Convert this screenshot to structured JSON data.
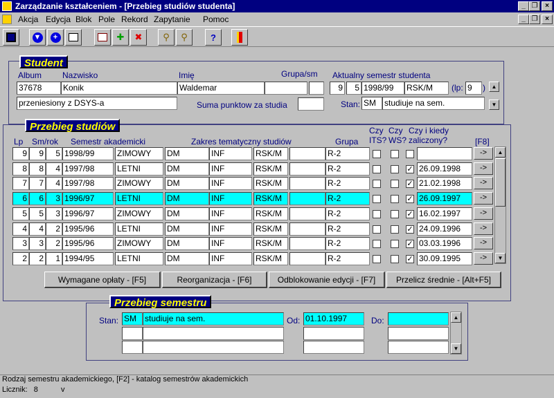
{
  "window": {
    "title": "Zarządzanie kształceniem - [Przebieg studiów studenta]"
  },
  "menu": [
    "Akcja",
    "Edycja",
    "Blok",
    "Pole",
    "Rekord",
    "Zapytanie",
    "Pomoc"
  ],
  "student": {
    "title": "Student",
    "labels": {
      "album": "Album",
      "nazwisko": "Nazwisko",
      "imie": "Imię",
      "grupa": "Grupa/sm",
      "aktualny": "Aktualny semestr studenta",
      "suma": "Suma punktow za studia",
      "stan": "Stan:",
      "lp_open": "(lp:",
      "lp_close": ")"
    },
    "album": "37678",
    "nazwisko": "Konik",
    "imie": "Waldemar",
    "grupa": "",
    "grupa_sm": "",
    "aktualny": {
      "a": "9",
      "b": "5",
      "year": "1998/99",
      "code": "RSK/M",
      "lp": "9"
    },
    "note": "przeniesiony z DSYS-a",
    "suma": "",
    "stan_code": "SM",
    "stan_text": "studiuje na sem."
  },
  "przebieg": {
    "title": "Przebieg studiów",
    "headers": {
      "lp": "Lp",
      "smrok": "Sm/rok",
      "sem": "Semestr akademicki",
      "zakres": "Zakres tematyczny studiów",
      "grupa": "Grupa",
      "czyits": "Czy ITS?",
      "czyws": "Czy WS?",
      "czykiedy": "Czy i kiedy zaliczony?",
      "f8": "[F8]"
    },
    "arrow_label": "->",
    "rows": [
      {
        "lp": "9",
        "sm": "9",
        "rok": "5",
        "year": "1998/99",
        "season": "ZIMOWY",
        "z1": "DM",
        "z2": "INF",
        "z3": "RSK/M",
        "grupa": "R-2",
        "its": "",
        "ws": "",
        "zal": "",
        "date": "",
        "active": false
      },
      {
        "lp": "8",
        "sm": "8",
        "rok": "4",
        "year": "1997/98",
        "season": "LETNI",
        "z1": "DM",
        "z2": "INF",
        "z3": "RSK/M",
        "grupa": "R-2",
        "its": "",
        "ws": "",
        "zal": "✓",
        "date": "26.09.1998",
        "active": false
      },
      {
        "lp": "7",
        "sm": "7",
        "rok": "4",
        "year": "1997/98",
        "season": "ZIMOWY",
        "z1": "DM",
        "z2": "INF",
        "z3": "RSK/M",
        "grupa": "R-2",
        "its": "",
        "ws": "",
        "zal": "✓",
        "date": "21.02.1998",
        "active": false
      },
      {
        "lp": "6",
        "sm": "6",
        "rok": "3",
        "year": "1996/97",
        "season": "LETNI",
        "z1": "DM",
        "z2": "INF",
        "z3": "RSK/M",
        "grupa": "R-2",
        "its": "",
        "ws": "",
        "zal": "✓",
        "date": "26.09.1997",
        "active": true
      },
      {
        "lp": "5",
        "sm": "5",
        "rok": "3",
        "year": "1996/97",
        "season": "ZIMOWY",
        "z1": "DM",
        "z2": "INF",
        "z3": "RSK/M",
        "grupa": "R-2",
        "its": "",
        "ws": "",
        "zal": "✓",
        "date": "16.02.1997",
        "active": false
      },
      {
        "lp": "4",
        "sm": "4",
        "rok": "2",
        "year": "1995/96",
        "season": "LETNI",
        "z1": "DM",
        "z2": "INF",
        "z3": "RSK/M",
        "grupa": "R-2",
        "its": "",
        "ws": "",
        "zal": "✓",
        "date": "24.09.1996",
        "active": false
      },
      {
        "lp": "3",
        "sm": "3",
        "rok": "2",
        "year": "1995/96",
        "season": "ZIMOWY",
        "z1": "DM",
        "z2": "INF",
        "z3": "RSK/M",
        "grupa": "R-2",
        "its": "",
        "ws": "",
        "zal": "✓",
        "date": "03.03.1996",
        "active": false
      },
      {
        "lp": "2",
        "sm": "2",
        "rok": "1",
        "year": "1994/95",
        "season": "LETNI",
        "z1": "DM",
        "z2": "INF",
        "z3": "RSK/M",
        "grupa": "R-2",
        "its": "",
        "ws": "",
        "zal": "✓",
        "date": "30.09.1995",
        "active": false
      }
    ],
    "buttons": {
      "oplaty": "Wymagane opłaty - [F5]",
      "reorg": "Reorganizacja - [F6]",
      "odblok": "Odblokowanie edycji - [F7]",
      "srednie": "Przelicz średnie - [Alt+F5]"
    }
  },
  "semestr": {
    "title": "Przebieg semestru",
    "labels": {
      "stan": "Stan:",
      "od": "Od:",
      "do": "Do:"
    },
    "rows": [
      {
        "code": "SM",
        "text": "studiuje na sem.",
        "od": "01.10.1997",
        "do": ""
      },
      {
        "code": "",
        "text": "",
        "od": "",
        "do": ""
      },
      {
        "code": "",
        "text": "",
        "od": "",
        "do": ""
      }
    ]
  },
  "status": {
    "hint": "Rodzaj semestru akademickiego, [F2] - katalog semestrów akademickich",
    "licznik_label": "Licznik:",
    "licznik": "8",
    "mode": "v"
  }
}
